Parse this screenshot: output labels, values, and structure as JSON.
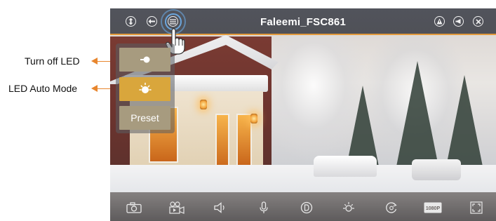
{
  "annotations": [
    {
      "label": "Turn off LED"
    },
    {
      "label": "LED Auto Mode"
    }
  ],
  "app": {
    "title": "Faleemi_FSC861"
  },
  "led_menu": {
    "preset_label": "Preset"
  },
  "toolbar": {
    "resolution_label": "1080P"
  },
  "icons": {
    "top_left": [
      "ptz-arrows-icon",
      "back-icon",
      "menu-list-icon"
    ],
    "top_right": [
      "alert-icon",
      "volume-icon",
      "close-icon"
    ],
    "led_menu": [
      "led-off-icon",
      "led-auto-sun-icon"
    ],
    "bottom": [
      "camera-snapshot-icon",
      "video-record-icon",
      "speaker-icon",
      "microphone-icon",
      "mode-d-icon",
      "brightness-sun-icon",
      "rotate-icon",
      "resolution-1080p-icon",
      "fullscreen-icon"
    ]
  },
  "colors": {
    "accent": "#e39a3b",
    "led_auto_active": "#d9a63c",
    "led_inactive": "#a79b7f",
    "arrow": "#e8862e"
  }
}
